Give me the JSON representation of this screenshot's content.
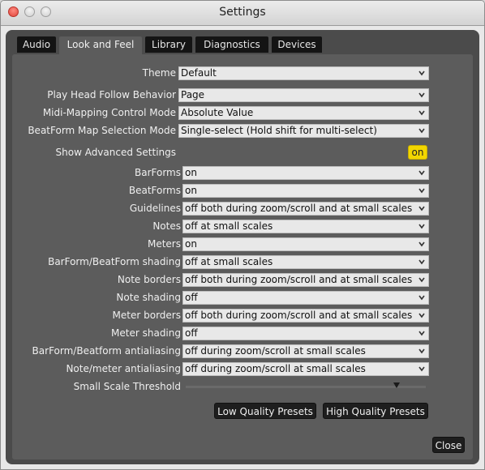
{
  "window": {
    "title": "Settings"
  },
  "tabs": [
    {
      "label": "Audio",
      "active": false
    },
    {
      "label": "Look and Feel",
      "active": true
    },
    {
      "label": "Library",
      "active": false
    },
    {
      "label": "Diagnostics",
      "active": false
    },
    {
      "label": "Devices",
      "active": false
    }
  ],
  "settings": {
    "theme": {
      "label": "Theme",
      "value": "Default"
    },
    "play_head": {
      "label": "Play Head Follow Behavior",
      "value": "Page"
    },
    "midi_mode": {
      "label": "Midi-Mapping Control Mode",
      "value": "Absolute Value"
    },
    "beatform_map": {
      "label": "BeatForm Map Selection Mode",
      "value": "Single-select (Hold shift for multi-select)"
    },
    "show_advanced": {
      "label": "Show Advanced Settings",
      "value": "on"
    }
  },
  "advanced": {
    "barforms": {
      "label": "BarForms",
      "value": "on"
    },
    "beatforms": {
      "label": "BeatForms",
      "value": "on"
    },
    "guidelines": {
      "label": "Guidelines",
      "value": "off both during zoom/scroll and at small scales"
    },
    "notes": {
      "label": "Notes",
      "value": "off at small scales"
    },
    "meters": {
      "label": "Meters",
      "value": "on"
    },
    "barform_shading": {
      "label": "BarForm/BeatForm shading",
      "value": "off at small scales"
    },
    "note_borders": {
      "label": "Note borders",
      "value": "off both during zoom/scroll and at small scales"
    },
    "note_shading": {
      "label": "Note shading",
      "value": "off"
    },
    "meter_borders": {
      "label": "Meter borders",
      "value": "off both during zoom/scroll and at small scales"
    },
    "meter_shading": {
      "label": "Meter shading",
      "value": "off"
    },
    "barform_antialiasing": {
      "label": "BarForm/Beatform antialiasing",
      "value": "off during zoom/scroll at small scales"
    },
    "note_antialiasing": {
      "label": "Note/meter antialiasing",
      "value": "off during zoom/scroll at small scales"
    },
    "small_scale_threshold": {
      "label": "Small Scale Threshold",
      "level": 0.88
    }
  },
  "buttons": {
    "low_quality": "Low Quality Presets",
    "high_quality": "High Quality Presets",
    "close": "Close"
  },
  "colors": {
    "toggle_on": "#f2d600",
    "panel": "#5c5c5c",
    "tab_inactive": "#141414"
  }
}
